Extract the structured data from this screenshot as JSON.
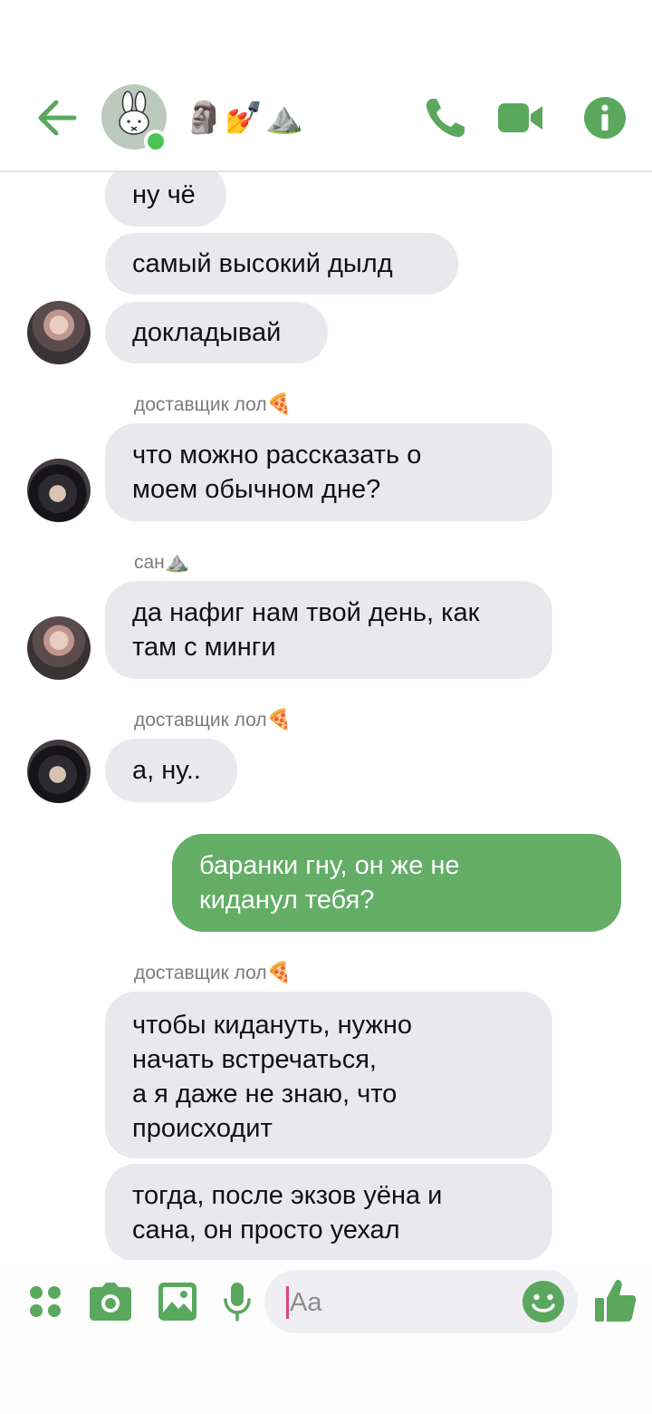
{
  "header": {
    "title_emoji": "🗿💅⛰️",
    "icons": [
      "back-arrow-icon",
      "phone-icon",
      "video-camera-icon",
      "info-icon"
    ],
    "accent_color": "#5aa85e",
    "online_color": "#48c554"
  },
  "messages": [
    {
      "direction": "in",
      "text": "ну чё"
    },
    {
      "direction": "in",
      "text": "самый высокий дылд"
    },
    {
      "direction": "in",
      "text": "докладывай"
    },
    {
      "sender": "доставщик лол",
      "sender_emoji": "🍕",
      "direction": "in",
      "text": "что можно рассказать о\nмоем обычном дне?"
    },
    {
      "sender": "сан",
      "sender_emoji": "⛰️",
      "direction": "in",
      "text": "да нафиг нам твой день, как\nтам с минги"
    },
    {
      "sender": "доставщик лол",
      "sender_emoji": "🍕",
      "direction": "in",
      "text": "а, ну.."
    },
    {
      "direction": "out",
      "text": "баранки гну, он же не\nкиданул тебя?"
    },
    {
      "sender": "доставщик лол",
      "sender_emoji": "🍕",
      "direction": "in",
      "text": "чтобы кидануть, нужно\nначать встречаться,\nа я даже не знаю, что\nпроисходит"
    },
    {
      "direction": "in",
      "text": "тогда, после экзов уёна и\nсана, он просто уехал"
    }
  ],
  "composer": {
    "placeholder": "Aa",
    "icons": [
      "apps-grid-icon",
      "camera-icon",
      "gallery-icon",
      "microphone-icon",
      "emoji-icon",
      "thumbs-up-icon"
    ]
  },
  "colors": {
    "incoming_bubble": "#e9e8ed",
    "outgoing_bubble": "#63ad66",
    "sender_text": "#7c7c7c"
  }
}
